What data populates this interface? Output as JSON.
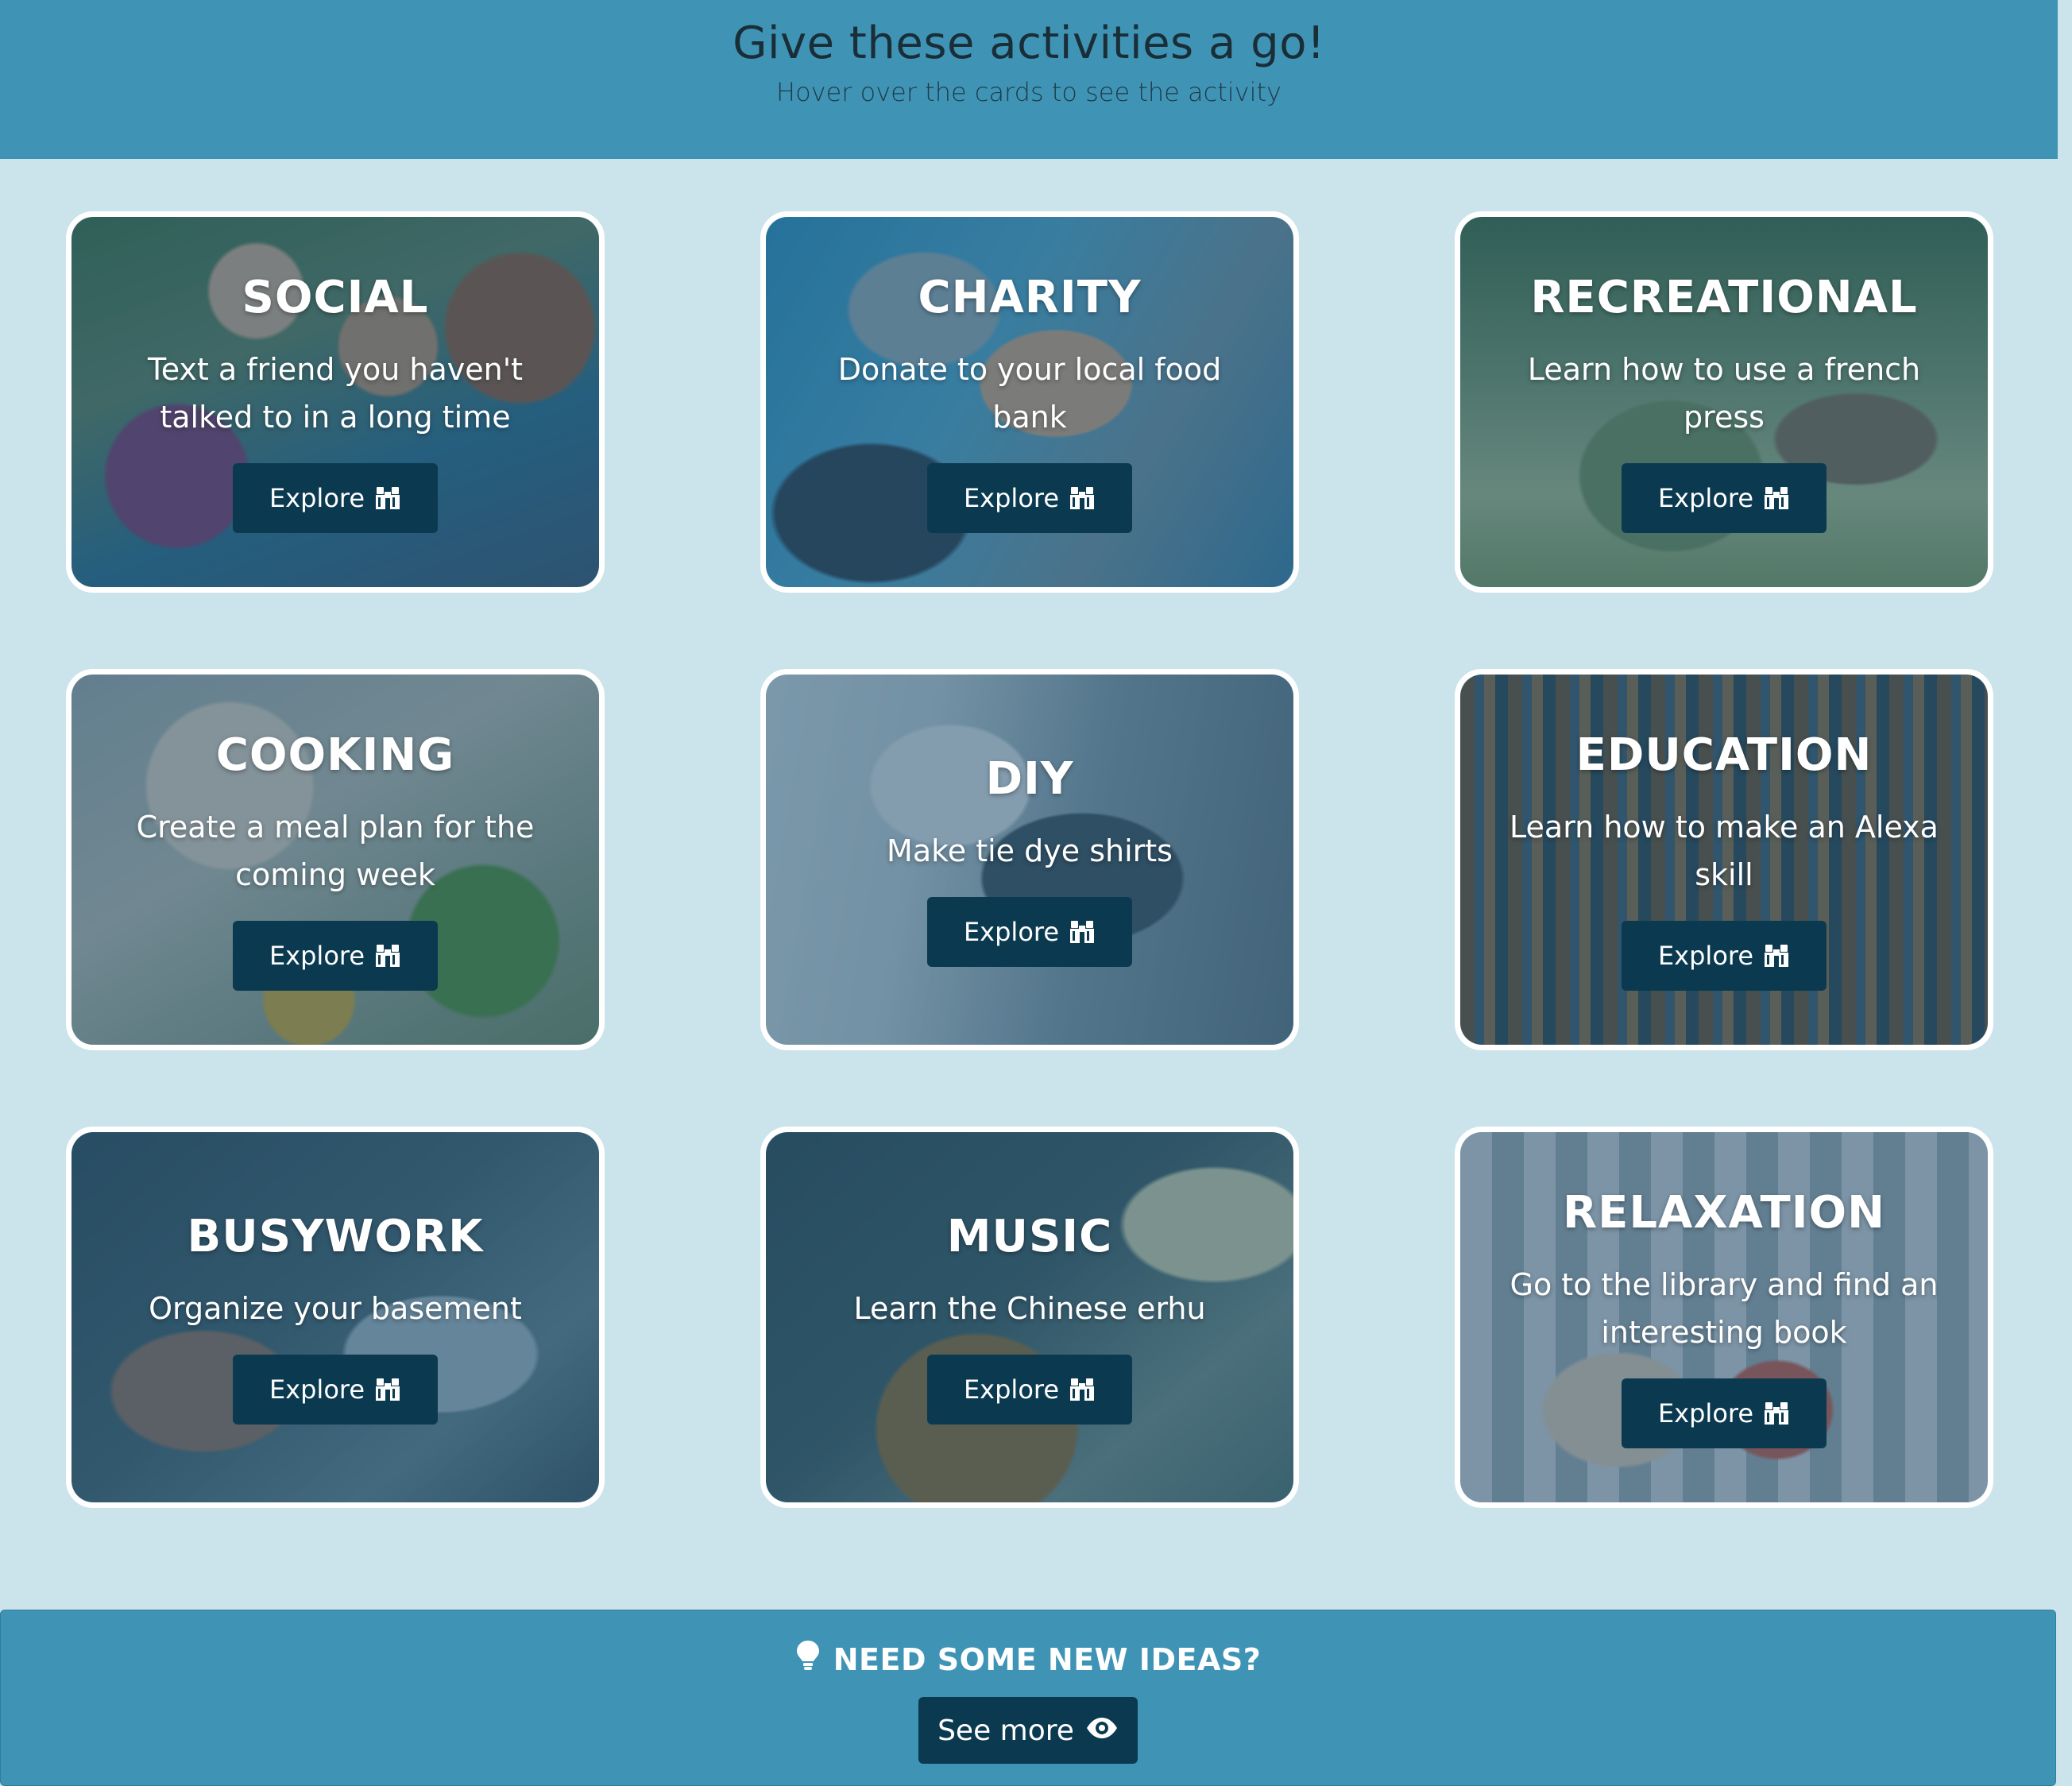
{
  "header": {
    "title": "Give these activities a go!",
    "subtitle": "Hover over the cards to see the activity"
  },
  "cards": [
    {
      "title": "SOCIAL",
      "description": "Text a friend you haven't talked to in a long time",
      "button": "Explore"
    },
    {
      "title": "CHARITY",
      "description": "Donate to your local food bank",
      "button": "Explore"
    },
    {
      "title": "RECREATIONAL",
      "description": "Learn how to use a french press",
      "button": "Explore"
    },
    {
      "title": "COOKING",
      "description": "Create a meal plan for the coming week",
      "button": "Explore"
    },
    {
      "title": "DIY",
      "description": "Make tie dye shirts",
      "button": "Explore"
    },
    {
      "title": "EDUCATION",
      "description": "Learn how to make an Alexa skill",
      "button": "Explore"
    },
    {
      "title": "BUSYWORK",
      "description": "Organize your basement",
      "button": "Explore"
    },
    {
      "title": "MUSIC",
      "description": "Learn the Chinese erhu",
      "button": "Explore"
    },
    {
      "title": "RELAXATION",
      "description": "Go to the library and find an interesting book",
      "button": "Explore"
    }
  ],
  "footer": {
    "ideas_label": "NEED SOME NEW IDEAS?",
    "see_more_label": "See more"
  },
  "icons": {
    "explore": "binoculars-icon",
    "ideas": "lightbulb-icon",
    "see_more": "eye-icon"
  },
  "colors": {
    "header_bg": "#3f94b6",
    "page_bg": "#cbe3ea",
    "button_bg": "#0b3a50",
    "card_border": "#ffffff"
  }
}
